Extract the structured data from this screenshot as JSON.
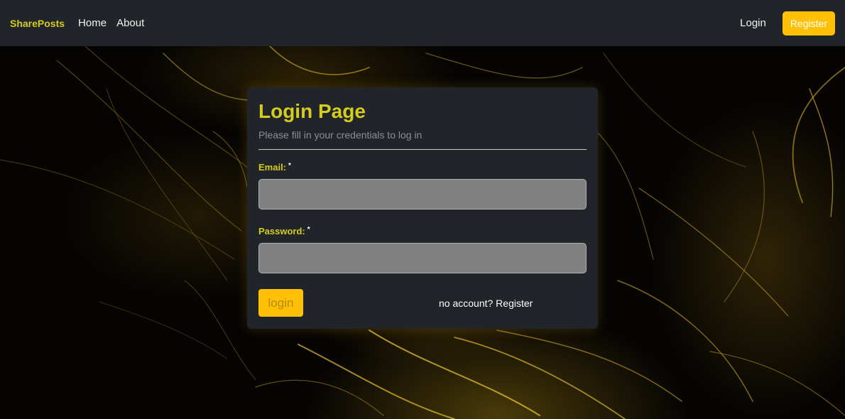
{
  "navbar": {
    "brand": "SharePosts",
    "links": [
      {
        "label": "Home"
      },
      {
        "label": "About"
      }
    ],
    "login_label": "Login",
    "register_label": "Register"
  },
  "login_card": {
    "title": "Login Page",
    "subtitle": "Please fill in your credentials to log in",
    "email_label": "Email:",
    "email_required_mark": "*",
    "email_value": "",
    "password_label": "Password:",
    "password_required_mark": "*",
    "password_value": "",
    "submit_label": "login",
    "register_link_text": "no account? Register"
  },
  "colors": {
    "accent_yellow": "#ffc107",
    "title_yellow": "#d4cc1e",
    "navbar_bg": "#212529",
    "card_bg": "#212529",
    "input_bg": "#808080"
  }
}
